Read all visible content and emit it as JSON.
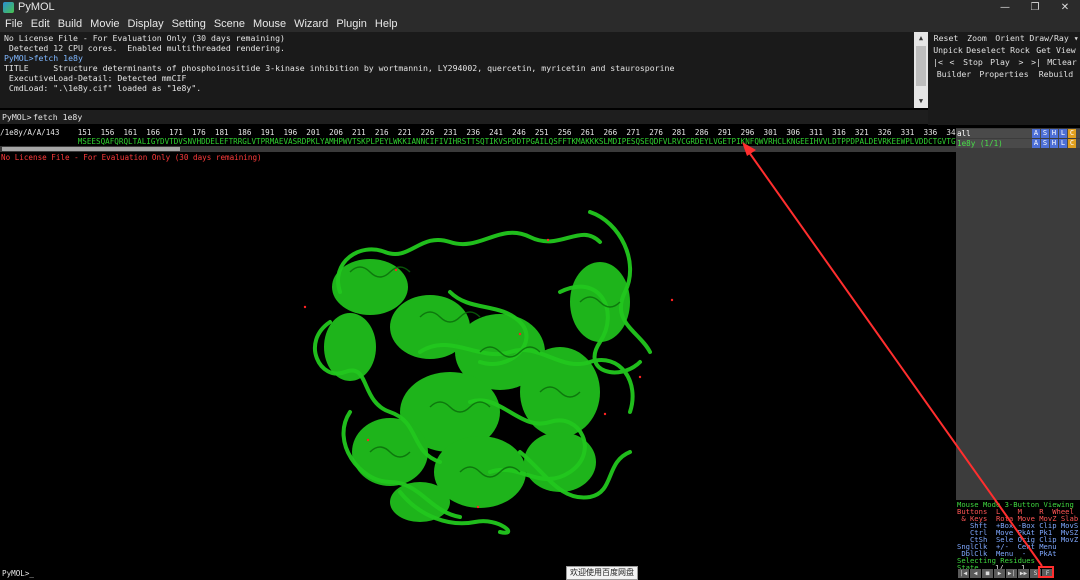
{
  "window": {
    "title": "PyMOL",
    "minimize": "—",
    "restore": "❐",
    "close": "✕"
  },
  "menu": [
    "File",
    "Edit",
    "Build",
    "Movie",
    "Display",
    "Setting",
    "Scene",
    "Mouse",
    "Wizard",
    "Plugin",
    "Help"
  ],
  "log": {
    "lines": [
      "No License File - For Evaluation Only (30 days remaining)",
      " Detected 12 CPU cores.  Enabled multithreaded rendering.",
      "PyMOL>fetch 1e8y",
      "TITLE     Structure determinants of phosphoinositide 3-kinase inhibition by wortmannin, LY294002, quercetin, myricetin and staurosporine",
      " ExecutiveLoad-Detail: Detected mmCIF",
      " CmdLoad: \".\\1e8y.cif\" loaded as \"1e8y\"."
    ]
  },
  "command": {
    "prompt": "PyMOL>",
    "value": "fetch 1e8y"
  },
  "buttons": {
    "row1": [
      "Reset",
      "Zoom",
      "Orient",
      "Draw/Ray ▾"
    ],
    "row2": [
      "Unpick",
      "Deselect",
      "Rock",
      "Get View"
    ],
    "row3": [
      "|<",
      "<",
      "Stop",
      "Play",
      ">",
      ">|",
      "MClear"
    ],
    "row4": [
      "Builder",
      "Properties",
      "Rebuild"
    ]
  },
  "sequence": {
    "numbers": "/1e8y/A/A/143    151  156  161  166  171  176  181  186  191  196  201  206  211  216  221  226  231  236  241  246  251  256  261  266  271  276  281  286  291  296  301  306  311  316  321  326  331  336  341",
    "residues": "                 MSEESQAFQRQLTALIGYDVTDVSNVHDDELEFTRRGLVTPRMAEVASRDPKLYAMHPWVTSKPLPEYLWKKIANNCIFIVIHRSTTSQTIKVSPDDTPGAILQSFFTKMAKKKSLMDIPESQSEQDFVLRVCGRDEYLVGETPIKNFQWVRHCLKNGEEIHVVLDTPPDPALDEVRKEEWPLVDDCTGVTGYHEQLTIHGKDHESVF"
  },
  "watermark": "No License File - For Evaluation Only (30 days remaining)",
  "objects": [
    {
      "name": "all",
      "name_color": "#ffffff",
      "buttons": [
        "A",
        "S",
        "H",
        "L",
        "C"
      ]
    },
    {
      "name": "1e8y (1/1)",
      "name_color": "#49e049",
      "buttons": [
        "A",
        "S",
        "H",
        "L",
        "C"
      ]
    }
  ],
  "mouse_panel": {
    "header": "Mouse Mode 3-Button Viewing",
    "buttons_row": "Buttons  L    M    R  Wheel",
    "keys_row": " & Keys  Rota Move MovZ Slab",
    "shft_row": "   Shft  +Box -Box Clip MovS",
    "ctrl_row": "   Ctrl  Move PkAt Pk1  MvSZ",
    "ctsh_row": "   CtSh  Sele Orig Clip MovZ",
    "snglclk_row": "SnglClk  +/-  Cent Menu",
    "dblclk_row": " DblClk  Menu  -   PkAt",
    "selecting": "Selecting Residues",
    "state_label": "State",
    "state_value": "   1/    1"
  },
  "bottom": {
    "prompt": "PyMOL>_",
    "tooltip": "欢迎使用百度网盘"
  },
  "playback": [
    "|◀",
    "◀",
    "■",
    "▶",
    "▶|",
    "▶▶",
    "S",
    "F"
  ],
  "colors": {
    "protein": "#22c81e",
    "annotation_red": "#ff2e2e",
    "log_blue": "#7fb7ff"
  }
}
